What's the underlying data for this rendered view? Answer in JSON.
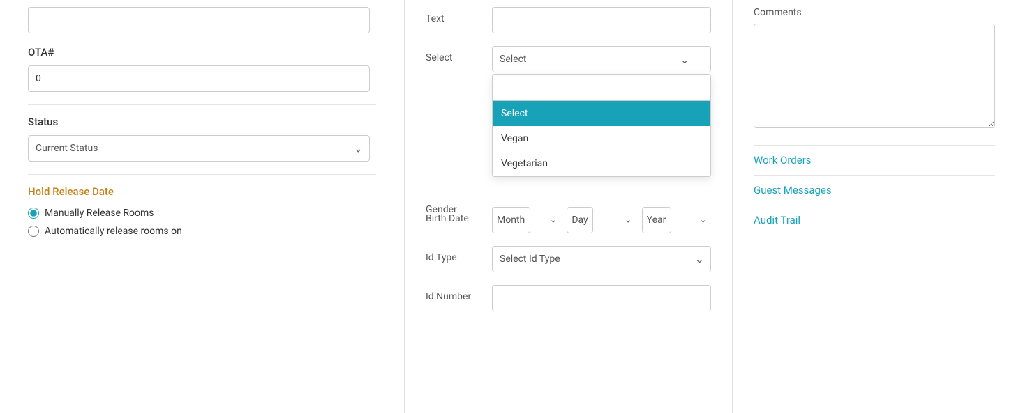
{
  "left": {
    "top_input_placeholder": "",
    "ota_label": "OTA#",
    "ota_value": "0",
    "status_label": "Status",
    "status_placeholder": "Current Status",
    "divider": true,
    "hold_release_title": "Hold Release Date",
    "manually_release_label": "Manually Release Rooms",
    "auto_release_label": "Automatically release rooms on",
    "manually_selected": true
  },
  "middle": {
    "text_label": "Text",
    "select_label": "Select",
    "select_placeholder": "Select",
    "gender_label": "Gender",
    "birth_date_label": "Birth Date",
    "birth_date_month_placeholder": "Month",
    "birth_date_day_placeholder": "Day",
    "birth_date_year_placeholder": "Year",
    "id_type_label": "Id Type",
    "id_type_placeholder": "Select Id Type",
    "id_number_label": "Id Number",
    "dropdown_search_placeholder": "",
    "dropdown_options": [
      {
        "value": "select",
        "label": "Select",
        "selected": true
      },
      {
        "value": "vegan",
        "label": "Vegan",
        "selected": false
      },
      {
        "value": "vegetarian",
        "label": "Vegetarian",
        "selected": false
      }
    ],
    "dropdown_open": true
  },
  "right": {
    "comments_label": "Comments",
    "comments_value": "",
    "links": [
      {
        "label": "Work Orders"
      },
      {
        "label": "Guest Messages"
      },
      {
        "label": "Audit Trail"
      }
    ]
  }
}
